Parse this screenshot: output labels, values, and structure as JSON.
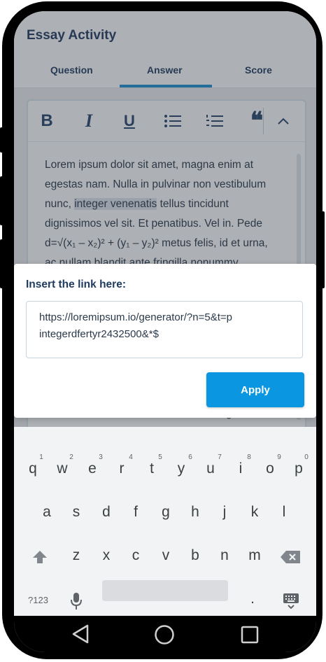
{
  "app": {
    "title": "Essay Activity"
  },
  "tabs": [
    {
      "label": "Question"
    },
    {
      "label": "Answer",
      "active": true
    },
    {
      "label": "Score"
    }
  ],
  "toolbar": {
    "bold_label": "B",
    "italic_label": "I",
    "underline_label": "U",
    "quote_label": "❝"
  },
  "editor": {
    "line1": "Lorem ipsum dolor sit amet, magna enim at",
    "line2": "egestas nam. Nulla in pulvinar non vestibulum",
    "line3_pre": "nunc, ",
    "line3_highlight": "integer venenatis",
    "line3_post": " tellus tincidunt",
    "line4": "dignissimos vel sit. Et penatibus. Vel in. Pede",
    "line5": "d=√(x₁ – x₂)² + (y₁ – y₂)²  metus felis, id et urna,",
    "line6": "ac nullam blandit ante fringilla nonummy",
    "behind_dialog": "nunc amet ac consectetuer elit, ac magna"
  },
  "dialog": {
    "title": "Insert the link here:",
    "url_line1": "https://loremipsum.io/generator/?n=5&t=p",
    "url_line2": "integerdfertyr2432500&*$",
    "apply_label": "Apply"
  },
  "keyboard": {
    "row1": [
      "q",
      "w",
      "e",
      "r",
      "t",
      "y",
      "u",
      "i",
      "o",
      "p"
    ],
    "row1_hints": [
      "1",
      "2",
      "3",
      "4",
      "5",
      "6",
      "7",
      "8",
      "9",
      "0"
    ],
    "row2": [
      "a",
      "s",
      "d",
      "f",
      "g",
      "h",
      "j",
      "k",
      "l"
    ],
    "row3": [
      "z",
      "x",
      "c",
      "v",
      "b",
      "n",
      "m"
    ],
    "symbols_label": "?123",
    "period_label": "."
  },
  "colors": {
    "accent": "#0a96e0",
    "title": "#1f3a5f",
    "tab_underline": "#1a8fd6"
  }
}
